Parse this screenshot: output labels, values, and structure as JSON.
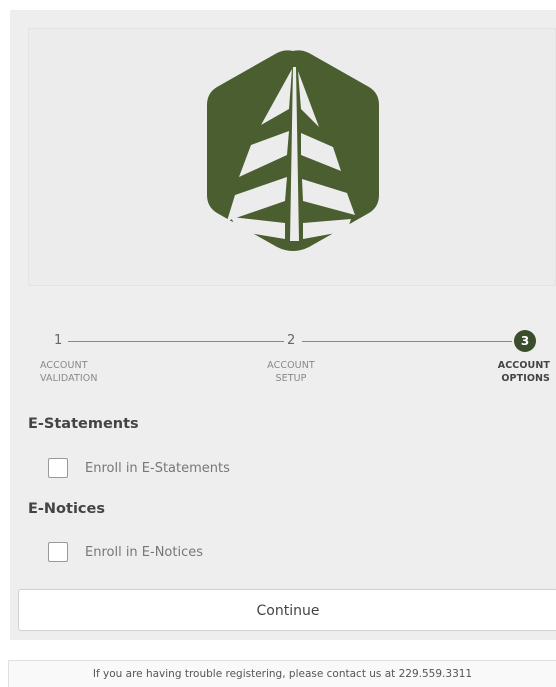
{
  "brand": {
    "accent_color": "#4a5e2f",
    "logo_icon": "pine-tree-hexagon-logo"
  },
  "stepper": {
    "steps": [
      {
        "number": "1",
        "label": "ACCOUNT\nVALIDATION",
        "state": "complete"
      },
      {
        "number": "2",
        "label": "ACCOUNT\nSETUP",
        "state": "complete"
      },
      {
        "number": "3",
        "label": "ACCOUNT\nOPTIONS",
        "state": "active"
      }
    ]
  },
  "estatements": {
    "title": "E-Statements",
    "checkbox_label": "Enroll in E-Statements",
    "checked": false
  },
  "enotices": {
    "title": "E-Notices",
    "checkbox_label": "Enroll in E-Notices",
    "checked": false
  },
  "continue_label": "Continue",
  "footer_text": "If you are having trouble registering, please contact us at 229.559.3311"
}
